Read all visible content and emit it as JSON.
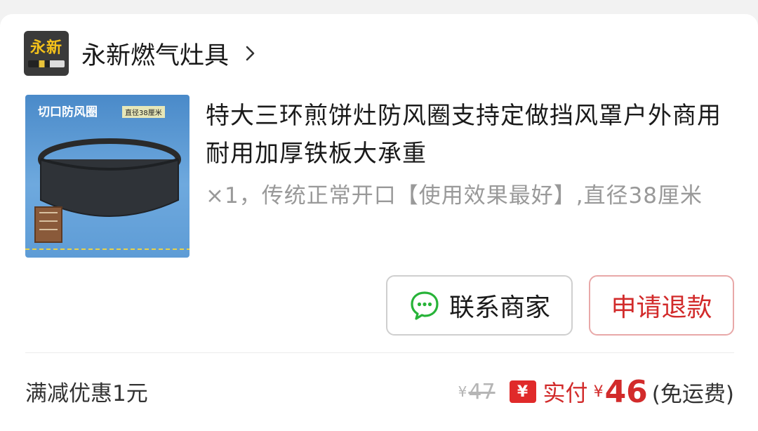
{
  "store": {
    "logo_text": "永新",
    "name": "永新燃气灶具"
  },
  "product": {
    "title": "特大三环煎饼灶防风圈支持定做挡风罩户外商用耐用加厚铁板大承重",
    "sku": "×1，传统正常开口【使用效果最好】,直径38厘米",
    "image_tag": "切口防风圈",
    "image_sub_tag": "直径38厘米"
  },
  "actions": {
    "contact": "联系商家",
    "refund": "申请退款"
  },
  "footer": {
    "discount": "满减优惠1元",
    "currency": "¥",
    "original_price": "47",
    "paid_badge": "¥",
    "paid_label": "实付",
    "paid_amount": "46",
    "shipping": "(免运费)"
  },
  "colors": {
    "accent_red": "#d22b2b",
    "wechat_green": "#27b338"
  },
  "icons": {
    "chevron": "chevron-right-icon",
    "chat": "chat-bubble-icon"
  }
}
